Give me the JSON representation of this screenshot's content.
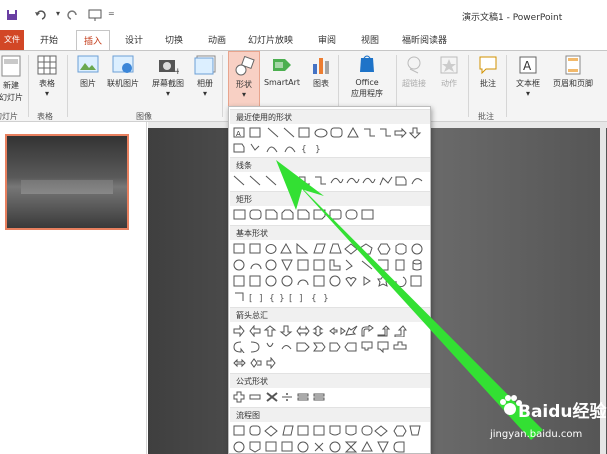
{
  "window": {
    "title": "演示文稿1 - PowerPoint",
    "help_icon": "?"
  },
  "quick_access": {
    "save_icon": "save-icon",
    "undo_icon": "undo-icon",
    "redo_icon": "redo-icon",
    "start_icon": "present-icon",
    "more_icon": "customize-icon"
  },
  "tabs": [
    "文件",
    "开始",
    "插入",
    "设计",
    "切换",
    "动画",
    "幻灯片放映",
    "审阅",
    "视图",
    "福昕阅读器"
  ],
  "active_tab": "插入",
  "ribbon": {
    "new_slide": "新建\n幻灯片",
    "new_slide_line1": "新建",
    "new_slide_line2": "幻灯片",
    "slides_group": "幻灯片",
    "table": "表格",
    "table_group": "表格",
    "picture": "图片",
    "online_picture": "联机图片",
    "screenshot": "屏幕截图",
    "album": "相册",
    "image_group": "图像",
    "shapes": "形状",
    "smartart": "SmartArt",
    "chart": "图表",
    "office_apps_line1": "Office",
    "office_apps_line2": "应用程序",
    "hyperlink": "超链接",
    "action": "动作",
    "comment": "批注",
    "comment_group": "批注",
    "textbox": "文本框",
    "header_footer": "页眉和页脚"
  },
  "shapes_menu": {
    "sections": [
      "最近使用的形状",
      "线条",
      "矩形",
      "基本形状",
      "箭头总汇",
      "公式形状",
      "流程图"
    ]
  },
  "slide_pane": {
    "slide_number": "1"
  },
  "watermark": {
    "brand": "Baidu经验",
    "url": "jingyan.baidu.com"
  },
  "colors": {
    "accent": "#d24726",
    "arrow": "#33e033"
  }
}
